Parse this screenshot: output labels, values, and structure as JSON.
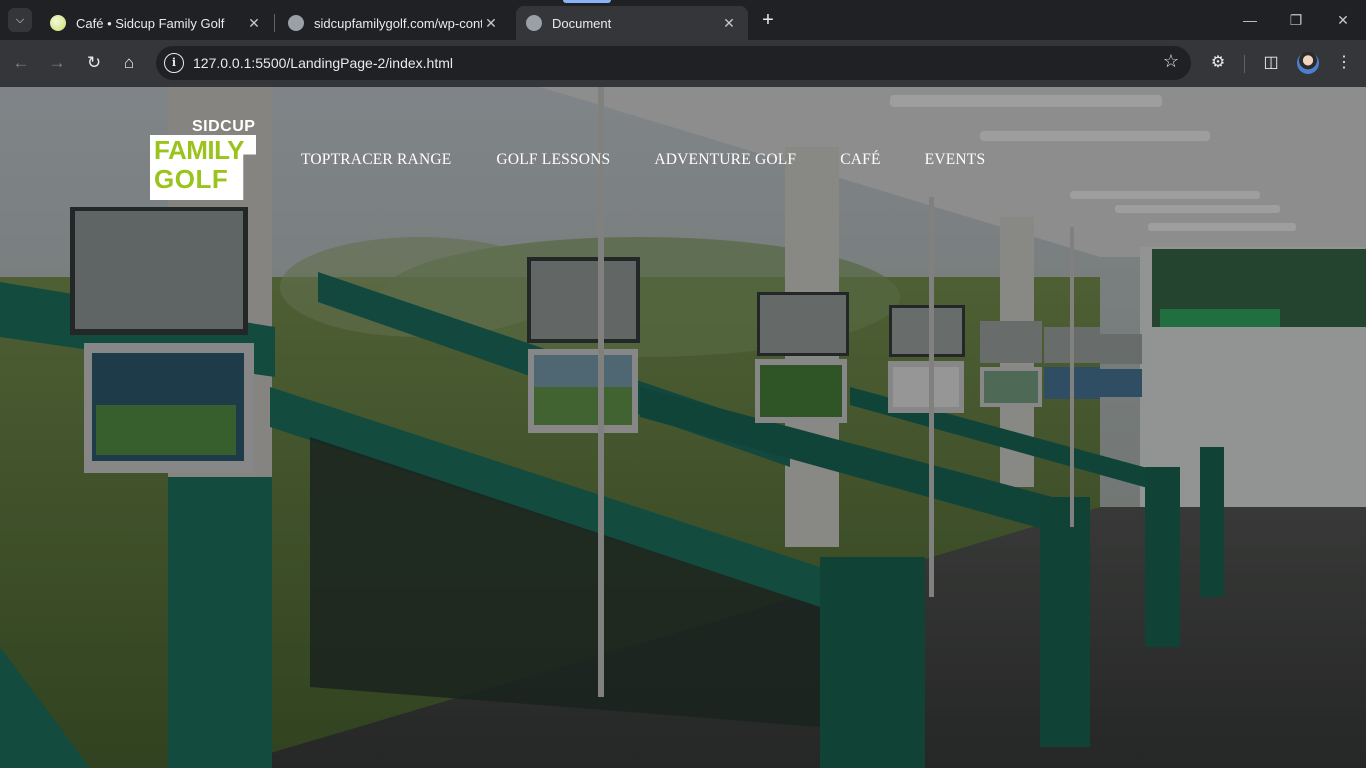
{
  "browser": {
    "tabs": [
      {
        "title": "Café • Sidcup Family Golf",
        "active": false
      },
      {
        "title": "sidcupfamilygolf.com/wp-conte",
        "active": false
      },
      {
        "title": "Document",
        "active": true
      }
    ],
    "url": "127.0.0.1:5500/LandingPage-2/index.html",
    "icons": {
      "tab_search": "chevron-down-icon",
      "new_tab": "plus-icon",
      "minimize": "minimize-icon",
      "restore": "restore-icon",
      "close": "close-icon",
      "back": "arrow-left-icon",
      "forward": "arrow-right-icon",
      "reload": "reload-icon",
      "home": "home-icon",
      "site_info": "info-icon",
      "bookmark": "star-icon",
      "extensions": "puzzle-icon",
      "side_panel": "side-panel-icon",
      "menu": "more-vert-icon"
    }
  },
  "site": {
    "logo": {
      "top": "SIDCUP",
      "line1": "FAMILY",
      "line2": "GOLF"
    },
    "nav": [
      {
        "label": "TOPTRACER RANGE"
      },
      {
        "label": "GOLF LESSONS"
      },
      {
        "label": "ADVENTURE GOLF"
      },
      {
        "label": "CAFÉ"
      },
      {
        "label": "EVENTS"
      }
    ],
    "colors": {
      "brand_green": "#9ac31c",
      "bay_teal": "#1f7a66",
      "overlay": "rgba(0,0,0,0.38)"
    }
  }
}
